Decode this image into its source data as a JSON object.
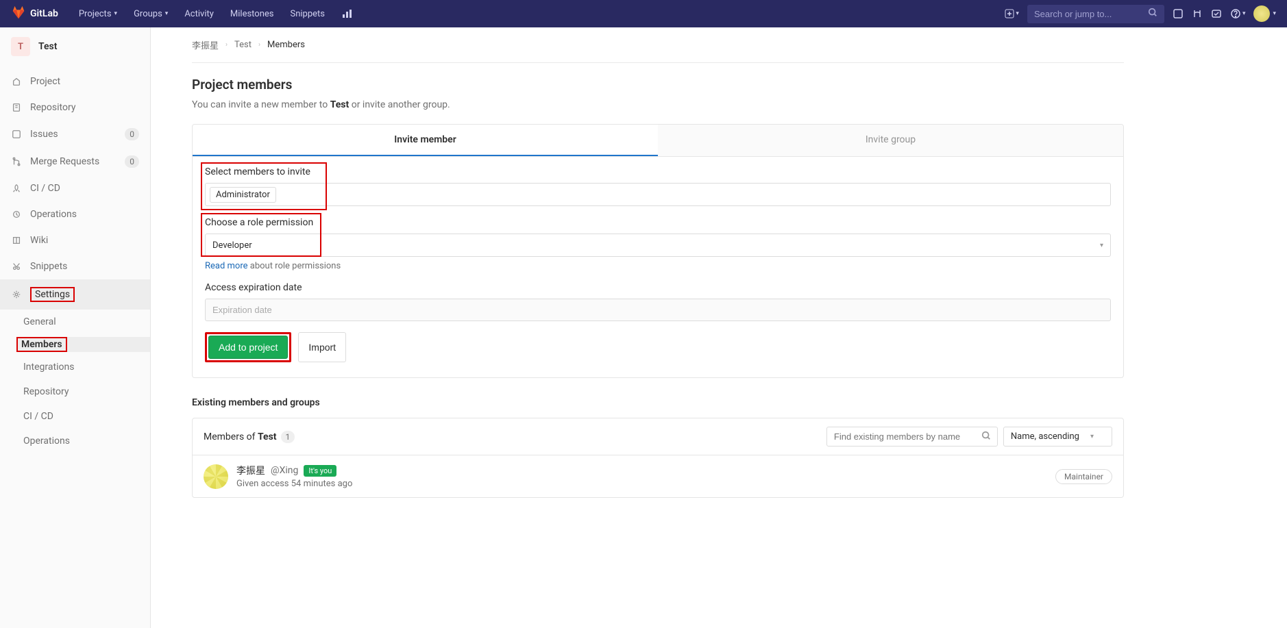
{
  "topnav": {
    "brand": "GitLab",
    "items": [
      "Projects",
      "Groups",
      "Activity",
      "Milestones",
      "Snippets"
    ],
    "search_placeholder": "Search or jump to..."
  },
  "sidebar": {
    "project_letter": "T",
    "project_name": "Test",
    "items": [
      {
        "label": "Project",
        "icon": "home"
      },
      {
        "label": "Repository",
        "icon": "repo"
      },
      {
        "label": "Issues",
        "icon": "issues",
        "badge": "0"
      },
      {
        "label": "Merge Requests",
        "icon": "merge",
        "badge": "0"
      },
      {
        "label": "CI / CD",
        "icon": "rocket"
      },
      {
        "label": "Operations",
        "icon": "ops"
      },
      {
        "label": "Wiki",
        "icon": "book"
      },
      {
        "label": "Snippets",
        "icon": "scissors"
      },
      {
        "label": "Settings",
        "icon": "gear",
        "highlight": true
      }
    ],
    "settings_children": [
      {
        "label": "General"
      },
      {
        "label": "Members",
        "active": true,
        "highlight": true
      },
      {
        "label": "Integrations"
      },
      {
        "label": "Repository"
      },
      {
        "label": "CI / CD"
      },
      {
        "label": "Operations"
      }
    ]
  },
  "breadcrumb": {
    "root": "李振星",
    "project": "Test",
    "page": "Members"
  },
  "page": {
    "title": "Project members",
    "subtitle_pre": "You can invite a new member to ",
    "subtitle_bold": "Test",
    "subtitle_post": " or invite another group."
  },
  "tabs": {
    "active": "Invite member",
    "inactive": "Invite group"
  },
  "form": {
    "select_label": "Select members to invite",
    "selected_member": "Administrator",
    "role_label": "Choose a role permission",
    "role_value": "Developer",
    "read_more": "Read more",
    "read_more_rest": " about role permissions",
    "expiration_label": "Access expiration date",
    "expiration_placeholder": "Expiration date",
    "add_btn": "Add to project",
    "import_btn": "Import"
  },
  "existing": {
    "section_title": "Existing members and groups",
    "members_of_pre": "Members of ",
    "members_of_bold": "Test",
    "count": "1",
    "find_placeholder": "Find existing members by name",
    "sort": "Name, ascending",
    "member": {
      "name": "李振星",
      "handle": "@Xing",
      "you": "It's you",
      "meta": "Given access 54 minutes ago",
      "role": "Maintainer"
    }
  }
}
